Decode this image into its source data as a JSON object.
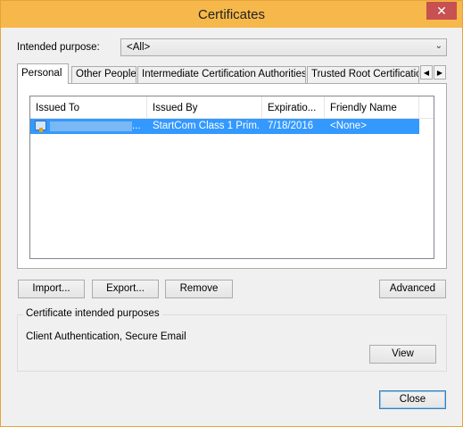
{
  "window": {
    "title": "Certificates",
    "close_glyph": "✕"
  },
  "purpose": {
    "label": "Intended purpose:",
    "selected": "<All>",
    "arrow": "⌄"
  },
  "tabs": [
    {
      "label": "Personal"
    },
    {
      "label": "Other People"
    },
    {
      "label": "Intermediate Certification Authorities"
    },
    {
      "label": "Trusted Root Certification Authorities"
    }
  ],
  "tab_scroll": {
    "left": "◀",
    "right": "▶"
  },
  "list": {
    "columns": [
      "Issued To",
      "Issued By",
      "Expiratio...",
      "Friendly Name"
    ],
    "rows": [
      {
        "issued_to": "...",
        "issued_by": "StartCom Class 1 Prim...",
        "expiration": "7/18/2016",
        "friendly_name": "<None>"
      }
    ]
  },
  "buttons": {
    "import": "Import...",
    "export": "Export...",
    "remove": "Remove",
    "advanced": "Advanced",
    "view": "View",
    "close": "Close"
  },
  "group": {
    "title": "Certificate intended purposes",
    "text": "Client Authentication, Secure Email"
  },
  "colors": {
    "titlebar": "#f6b84a",
    "selection": "#3399ff",
    "close_button": "#c75050"
  }
}
